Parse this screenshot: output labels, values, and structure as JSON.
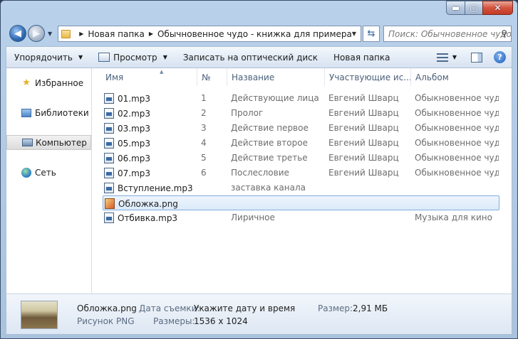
{
  "window": {
    "caption": {
      "min": "▬",
      "max": "▢",
      "close": "✕"
    }
  },
  "address": {
    "crumbs": [
      "Новая папка",
      "Обычновенное чудо - книжка для примера"
    ],
    "search_placeholder": "Поиск: Обычновенное чудо"
  },
  "toolbar": {
    "organize": "Упорядочить",
    "view": "Просмотр",
    "burn": "Записать на оптический диск",
    "new_folder": "Новая папка",
    "help": "?"
  },
  "nav": {
    "items": [
      {
        "label": "Избранное",
        "icon": "star-icon"
      },
      {
        "label": "Библиотеки",
        "icon": "library-icon"
      },
      {
        "label": "Компьютер",
        "icon": "computer-icon",
        "selected": true
      },
      {
        "label": "Сеть",
        "icon": "network-icon"
      }
    ]
  },
  "columns": {
    "name": "Имя",
    "num": "№",
    "title": "Название",
    "artists": "Участвующие ис...",
    "album": "Альбом"
  },
  "files": [
    {
      "name": "01.mp3",
      "num": "1",
      "title": "Действующие лица",
      "artist": "Евгений Шварц",
      "album": "Обыкновенное чудо",
      "type": "audio"
    },
    {
      "name": "02.mp3",
      "num": "2",
      "title": "Пролог",
      "artist": "Евгений Шварц",
      "album": "Обыкновенное чудо",
      "type": "audio"
    },
    {
      "name": "03.mp3",
      "num": "3",
      "title": "Действие первое",
      "artist": "Евгений Шварц",
      "album": "Обыкновенное чудо",
      "type": "audio"
    },
    {
      "name": "05.mp3",
      "num": "4",
      "title": "Действие второе",
      "artist": "Евгений Шварц",
      "album": "Обыкновенное чудо",
      "type": "audio"
    },
    {
      "name": "06.mp3",
      "num": "5",
      "title": "Действие третье",
      "artist": "Евгений Шварц",
      "album": "Обыкновенное чудо",
      "type": "audio"
    },
    {
      "name": "07.mp3",
      "num": "6",
      "title": "Послесловие",
      "artist": "Евгений Шварц",
      "album": "Обыкновенное чудо",
      "type": "audio"
    },
    {
      "name": "Вступление.mp3",
      "num": "",
      "title": "заставка канала",
      "artist": "",
      "album": "",
      "type": "audio"
    },
    {
      "name": "Обложка.png",
      "num": "",
      "title": "",
      "artist": "",
      "album": "",
      "type": "image",
      "selected": true
    },
    {
      "name": "Отбивка.mp3",
      "num": "",
      "title": "Лиричное",
      "artist": "",
      "album": "Музыка для кино",
      "type": "audio"
    }
  ],
  "details": {
    "filename": "Обложка.png",
    "filetype": "Рисунок PNG",
    "date_label": "Дата съемки:",
    "date_value": "Укажите дату и время",
    "dims_label": "Размеры:",
    "dims_value": "1536 x 1024",
    "size_label": "Размер:",
    "size_value": "2,91 МБ"
  },
  "colors": {
    "selection_border": "#84acdd",
    "chrome": "#b9d1ea",
    "close": "#c23b23"
  }
}
